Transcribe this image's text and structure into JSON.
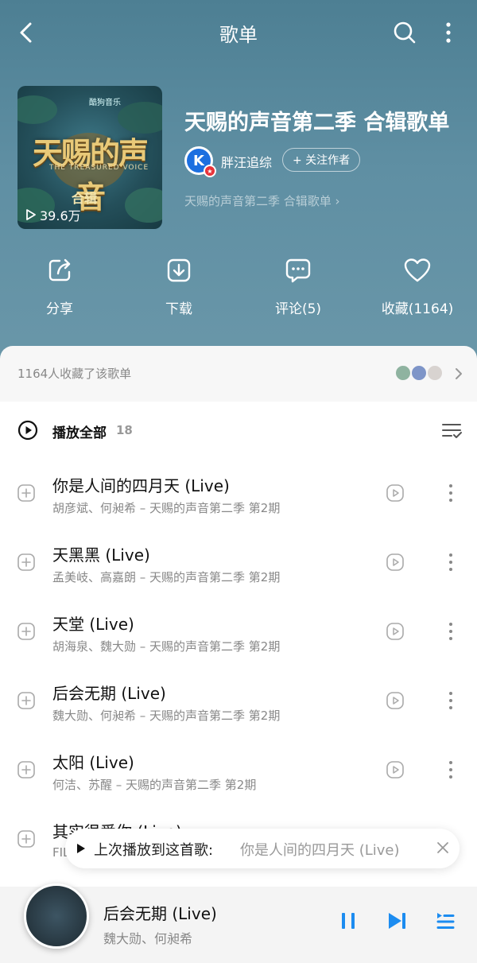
{
  "header": {
    "title": "歌单"
  },
  "cover": {
    "brand": "酷狗音乐",
    "logo_text": "天赐的声音",
    "logo_sub": "THE TREASURED VOICE",
    "tag": "合辑",
    "play_count": "39.6万"
  },
  "playlist": {
    "title": "天赐的声音第二季 合辑歌单",
    "author": "胖汪追综",
    "author_avatar_letter": "K",
    "follow_label": "+ 关注作者",
    "description": "天赐的声音第二季 合辑歌单 ›"
  },
  "actions": [
    {
      "label": "分享",
      "icon": "share-icon"
    },
    {
      "label": "下载",
      "icon": "download-icon"
    },
    {
      "label": "评论(5)",
      "icon": "comment-icon"
    },
    {
      "label": "收藏(1164)",
      "icon": "heart-icon"
    }
  ],
  "collect": {
    "text": "1164人收藏了该歌单"
  },
  "play_all": {
    "label": "播放全部",
    "count": "18"
  },
  "songs": [
    {
      "title": "你是人间的四月天 (Live)",
      "meta": "胡彦斌、何昶希 – 天赐的声音第二季 第2期"
    },
    {
      "title": "天黑黑 (Live)",
      "meta": "孟美岐、高嘉朗 – 天赐的声音第二季 第2期"
    },
    {
      "title": "天堂 (Live)",
      "meta": "胡海泉、魏大勋 – 天赐的声音第二季 第2期"
    },
    {
      "title": "后会无期 (Live)",
      "meta": "魏大勋、何昶希 – 天赐的声音第二季 第2期"
    },
    {
      "title": "太阳 (Live)",
      "meta": "何洁、苏醒 – 天赐的声音第二季 第2期"
    },
    {
      "title": "其实很爱你 (Live)",
      "meta": "FIL"
    }
  ],
  "resume": {
    "label": "上次播放到这首歌:",
    "song": "你是人间的四月天 (Live)"
  },
  "player": {
    "title": "后会无期 (Live)",
    "artist": "魏大勋、何昶希"
  },
  "colors": {
    "hero_top": "#4d7f93",
    "accent": "#1c8cf0",
    "text_dark": "#111111",
    "text_muted": "#888888"
  }
}
